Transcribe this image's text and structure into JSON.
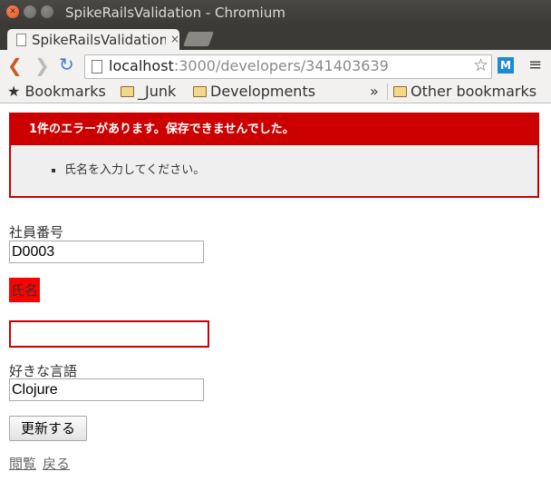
{
  "window": {
    "title": "SpikeRailsValidation - Chromium"
  },
  "tab": {
    "title": "SpikeRailsValidation",
    "close": "×"
  },
  "toolbar": {
    "url_host": "localhost",
    "url_path": ":3000/developers/341403639",
    "ext_label": "M"
  },
  "bookmarks": {
    "bookmarks_label": "Bookmarks",
    "items": [
      "_Junk",
      "Developments"
    ],
    "overflow": "»",
    "other": "Other bookmarks"
  },
  "errors": {
    "heading": "1件のエラーがあります。保存できませんでした。",
    "messages": [
      "氏名を入力してください。"
    ]
  },
  "form": {
    "employee_no_label": "社員番号",
    "employee_no_value": "D0003",
    "name_label": "氏名",
    "name_value": "",
    "language_label": "好きな言語",
    "language_value": "Clojure",
    "submit_label": "更新する"
  },
  "links": {
    "show": "閲覧",
    "back": "戻る"
  },
  "icons": [
    "close-icon",
    "minimize-icon",
    "maximize-icon",
    "page-icon",
    "back-icon",
    "forward-icon",
    "reload-icon",
    "star-icon",
    "extension-icon",
    "menu-icon",
    "folder-icon"
  ]
}
